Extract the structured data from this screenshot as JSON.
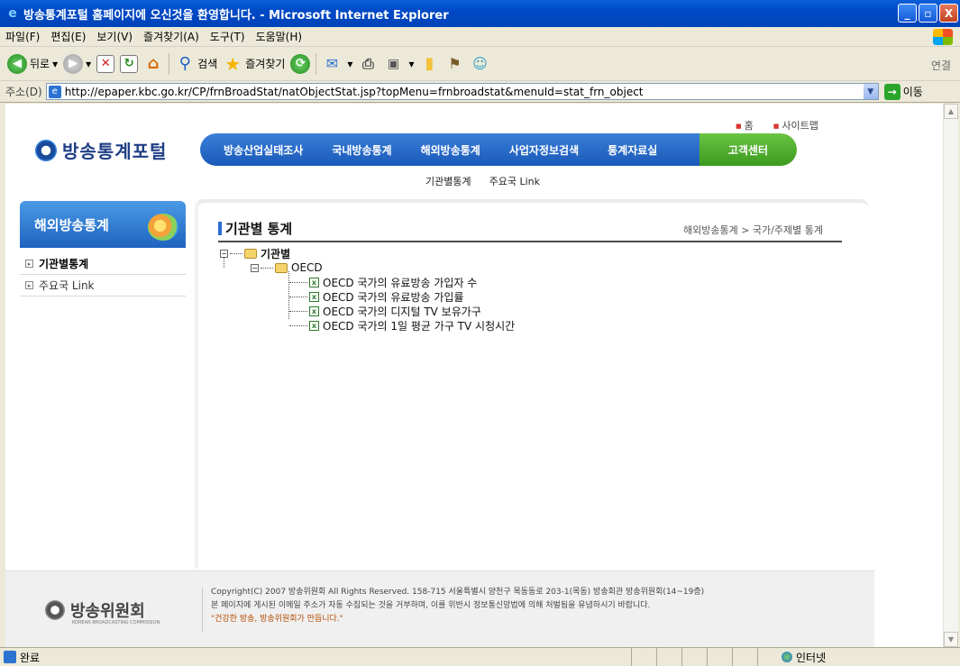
{
  "window": {
    "title": "방송통계포털 홈페이지에 오신것을 환영합니다. - Microsoft Internet Explorer",
    "minimize": "_",
    "maximize": "▫",
    "close": "X"
  },
  "menu": [
    "파일(F)",
    "편집(E)",
    "보기(V)",
    "즐겨찾기(A)",
    "도구(T)",
    "도움말(H)"
  ],
  "toolbar": {
    "back_label": "뒤로",
    "search_label": "검색",
    "favorites_label": "즐겨찾기",
    "links_label": "연결"
  },
  "address": {
    "label": "주소(D)",
    "url": "http://epaper.kbc.go.kr/CP/frnBroadStat/natObjectStat.jsp?topMenu=frnbroadstat&menuId=stat_frn_object",
    "go_label": "이동"
  },
  "page": {
    "top_links": [
      "홈",
      "사이트맵"
    ],
    "logo_text": "방송통계포털",
    "gnb": [
      "방송산업실태조사",
      "국내방송통계",
      "해외방송통계",
      "사업자정보검색",
      "통계자료실"
    ],
    "gnb_cs": "고객센터",
    "subnav": [
      "기관별통계",
      "주요국 Link"
    ],
    "lnb_title": "해외방송통계",
    "lnb_items": [
      "기관별통계",
      "주요국 Link"
    ],
    "content_title": "기관별 통계",
    "breadcrumb": "해외방송통계 > 국가/주제별 통계",
    "tree": {
      "root": "기관별",
      "group": "OECD",
      "items": [
        "OECD 국가의 유료방송 가입자 수",
        "OECD 국가의 유료방송 가입률",
        "OECD 국가의 디지털 TV 보유가구",
        "OECD 국가의 1일 평균 가구 TV 시청시간"
      ]
    },
    "footer": {
      "logo_text": "방송위원회",
      "logo_sub": "KOREAN BROADCASTING COMMISSION",
      "line1": "Copyright(C) 2007 방송위원회 All Rights Reserved.   158-715  서울특별시 양천구 목동동로 203-1(목동) 방송회관 방송위원회(14~19층)",
      "line2": "본 페이지에 게시된 이메일 주소가 자동 수집되는 것을 거부하며, 이를 위반시 정보통신망법에 의해 처벌됨을 유념하시기 바랍니다.",
      "slogan": "\"건강한 방송, 방송위원회가 만듭니다.\""
    }
  },
  "status": {
    "text": "완료",
    "zone": "인터넷"
  }
}
